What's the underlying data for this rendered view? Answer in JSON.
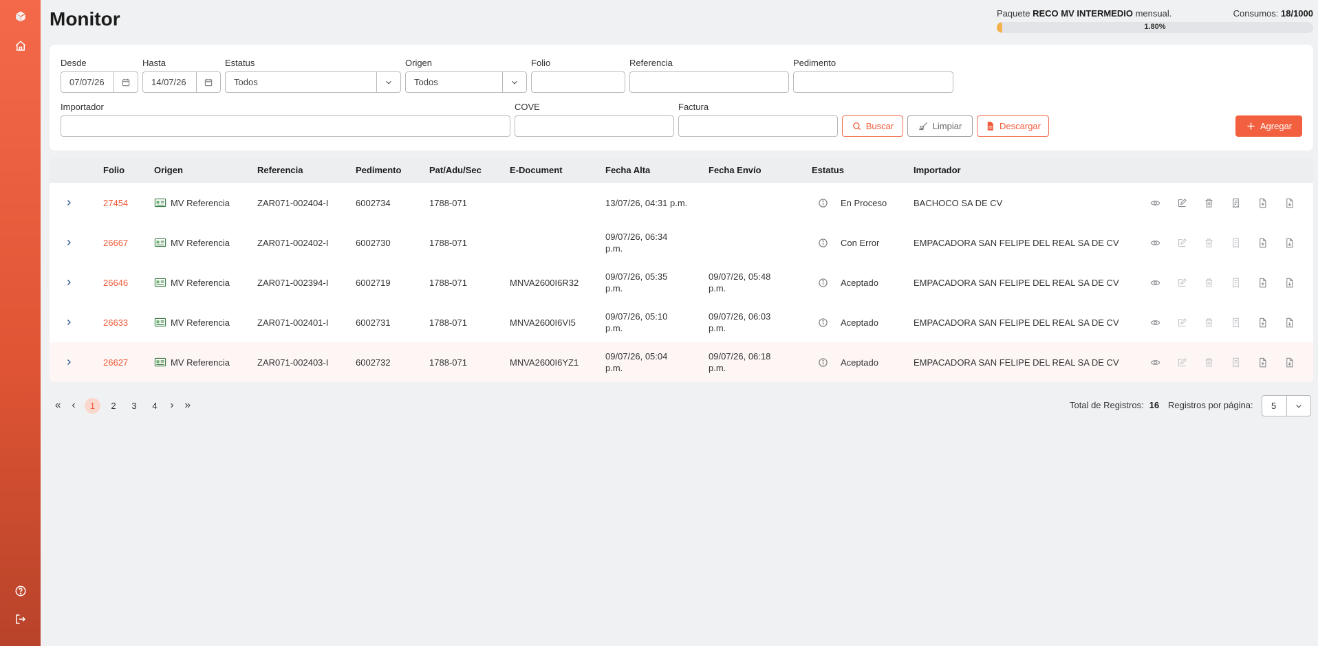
{
  "header": {
    "title": "Monitor",
    "package_prefix": "Paquete",
    "package_name": "RECO MV INTERMEDIO",
    "package_suffix": "mensual.",
    "consumption_label": "Consumos:",
    "consumption_value": "18/1000",
    "progress_percent": 1.8,
    "progress_label": "1.80%"
  },
  "sidebar": {
    "icons": [
      "logo-cube-icon",
      "home-icon",
      "help-icon",
      "logout-icon"
    ]
  },
  "filters": {
    "desde_label": "Desde",
    "desde_value": "07/07/26",
    "hasta_label": "Hasta",
    "hasta_value": "14/07/26",
    "estatus_label": "Estatus",
    "estatus_value": "Todos",
    "origen_label": "Origen",
    "origen_value": "Todos",
    "folio_label": "Folio",
    "referencia_label": "Referencia",
    "pedimento_label": "Pedimento",
    "importador_label": "Importador",
    "cove_label": "COVE",
    "factura_label": "Factura",
    "buscar_label": "Buscar",
    "limpiar_label": "Limpiar",
    "descargar_label": "Descargar",
    "agregar_label": "Agregar"
  },
  "table": {
    "headers": {
      "folio": "Folio",
      "origen": "Origen",
      "referencia": "Referencia",
      "pedimento": "Pedimento",
      "pat": "Pat/Adu/Sec",
      "edoc": "E-Document",
      "alta": "Fecha Alta",
      "envio": "Fecha Envío",
      "estatus": "Estatus",
      "importador": "Importador"
    },
    "rows": [
      {
        "folio": "27454",
        "origen": "MV Referencia",
        "referencia": "ZAR071-002404-I",
        "pedimento": "6002734",
        "pat": "1788-071",
        "edoc": "",
        "alta1": "13/07/26, 04:31 p.m.",
        "alta2": "",
        "envio1": "",
        "envio2": "",
        "estatus": "En Proceso",
        "importador": "BACHOCO SA DE CV"
      },
      {
        "folio": "26667",
        "origen": "MV Referencia",
        "referencia": "ZAR071-002402-I",
        "pedimento": "6002730",
        "pat": "1788-071",
        "edoc": "",
        "alta1": "09/07/26, 06:34",
        "alta2": "p.m.",
        "envio1": "",
        "envio2": "",
        "estatus": "Con Error",
        "importador": "EMPACADORA SAN FELIPE DEL REAL SA DE CV"
      },
      {
        "folio": "26646",
        "origen": "MV Referencia",
        "referencia": "ZAR071-002394-I",
        "pedimento": "6002719",
        "pat": "1788-071",
        "edoc": "MNVA2600I6R32",
        "alta1": "09/07/26, 05:35",
        "alta2": "p.m.",
        "envio1": "09/07/26, 05:48",
        "envio2": "p.m.",
        "estatus": "Aceptado",
        "importador": "EMPACADORA SAN FELIPE DEL REAL SA DE CV"
      },
      {
        "folio": "26633",
        "origen": "MV Referencia",
        "referencia": "ZAR071-002401-I",
        "pedimento": "6002731",
        "pat": "1788-071",
        "edoc": "MNVA2600I6VI5",
        "alta1": "09/07/26, 05:10",
        "alta2": "p.m.",
        "envio1": "09/07/26, 06:03",
        "envio2": "p.m.",
        "estatus": "Aceptado",
        "importador": "EMPACADORA SAN FELIPE DEL REAL SA DE CV"
      },
      {
        "folio": "26627",
        "origen": "MV Referencia",
        "referencia": "ZAR071-002403-I",
        "pedimento": "6002732",
        "pat": "1788-071",
        "edoc": "MNVA2600I6YZ1",
        "alta1": "09/07/26, 05:04",
        "alta2": "p.m.",
        "envio1": "09/07/26, 06:18",
        "envio2": "p.m.",
        "estatus": "Aceptado",
        "importador": "EMPACADORA SAN FELIPE DEL REAL SA DE CV"
      }
    ]
  },
  "pagination": {
    "pages": [
      "1",
      "2",
      "3",
      "4"
    ],
    "current": "1",
    "total_label": "Total de Registros:",
    "total_value": "16",
    "perpage_label": "Registros por página:",
    "perpage_value": "5"
  },
  "colors": {
    "accent": "#f2603f",
    "folio": "#ef5a38",
    "progress": "#f6b24a"
  }
}
